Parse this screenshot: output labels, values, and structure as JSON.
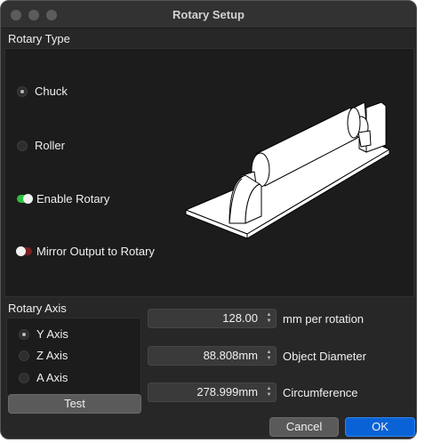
{
  "window": {
    "title": "Rotary Setup"
  },
  "rotary_type": {
    "label": "Rotary Type",
    "options": [
      {
        "label": "Chuck",
        "selected": true
      },
      {
        "label": "Roller",
        "selected": false
      }
    ],
    "enable_rotary": {
      "label": "Enable Rotary",
      "on": true
    },
    "mirror_output": {
      "label": "Mirror Output to Rotary",
      "on": false
    }
  },
  "rotary_axis": {
    "label": "Rotary Axis",
    "options": [
      {
        "label": "Y Axis",
        "selected": true
      },
      {
        "label": "Z Axis",
        "selected": false
      },
      {
        "label": "A Axis",
        "selected": false
      }
    ],
    "test_label": "Test"
  },
  "settings": {
    "mm_per_rotation": {
      "value": "128.00",
      "label": "mm per rotation"
    },
    "object_diameter": {
      "value": "88.808mm",
      "label": "Object Diameter"
    },
    "circumference": {
      "value": "278.999mm",
      "label": "Circumference"
    }
  },
  "buttons": {
    "cancel": "Cancel",
    "ok": "OK"
  },
  "colors": {
    "accent": "#0a63d6",
    "toggle_on": "#2fbf3f",
    "toggle_off": "#7a2020"
  },
  "illustration": "chuck-rotary-device"
}
